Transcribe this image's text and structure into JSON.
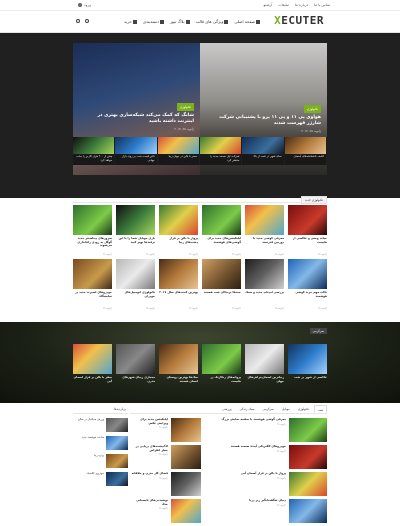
{
  "topbar": {
    "login": "ورود",
    "links": [
      "تماس با ما",
      "درباره ما",
      "تبلیغات",
      "آرشیو"
    ]
  },
  "header": {
    "logo_prefix": "X",
    "logo_rest": "ECUTER",
    "nav": [
      "صفحه اصلی",
      "ویژگی های قالب",
      "بلاگ نیوز",
      "دسته‌بندی",
      "خرید"
    ]
  },
  "hero": {
    "left": {
      "tag": "تکنولوژی",
      "title": "شانگ که کمک می‌کند شبکه‌سازی بهتری در اینترنت داشته باشید",
      "meta": "ژانویه ۲۸، ۲۰۱۷"
    },
    "right": {
      "tag": "تکنولوژی",
      "title": "هواوی پی ۱۱ و پی ۱۱ پرو با پشتیبانی شرکت شارژر فهرست شدند",
      "meta": "ژانویه ۲۸، ۲۰۱۷"
    },
    "strip": [
      "بیش از ۲۰۰ هزار کاربر را جذب خواهد کرد",
      "تاثیر قیمت نفت بر روی بازار جهانی",
      "سفر با بالن در جهان زیبا",
      "شرکت اپل نسخه جدید را منتشر کرد",
      "نمای شهر در شب از بالا",
      "کشف ناشناخته‌های آسمان"
    ]
  },
  "section1": {
    "label": "تکنولوژی جدید",
    "cards": [
      {
        "title": "سرورهای دیتاسنتر جدید گوگل به زودی راه‌اندازی می‌شوند",
        "meta": "ژانویه ۲۸"
      },
      {
        "title": "بازی موبایل شما را با این ترفندها بهتر کنید",
        "meta": "ژانویه ۲۸"
      },
      {
        "title": "پرواز با بالن بر فراز دشت‌های زیبا",
        "meta": "ژانویه ۲۸"
      },
      {
        "title": "اپلیکیشن‌های جدید برای گوشی‌های هوشمند",
        "meta": "ژانویه ۲۸"
      },
      {
        "title": "معرفی گوشی جدید با دوربین قدرتمند",
        "meta": "ژانویه ۲۸"
      },
      {
        "title": "حیات وحش و عکاسی از طبیعت",
        "meta": "ژانویه ۲۸"
      },
      {
        "title": "خودروهای اسپرت جدید در نمایشگاه",
        "meta": "ژانویه ۲۸"
      },
      {
        "title": "تکنولوژی اتومبیل‌های خودران",
        "meta": "ژانویه ۲۸"
      },
      {
        "title": "بهترین گجت‌های سال ۲۰۱۷",
        "meta": "ژانویه ۲۸"
      },
      {
        "title": "جغدها پرندگان شب هستند",
        "meta": "ژانویه ۲۸"
      },
      {
        "title": "بررسی لپ‌تاپ جدید و سبک",
        "meta": "ژانویه ۲۸"
      },
      {
        "title": "نکات مهم خرید گوشی هوشمند",
        "meta": "ژانویه ۲۸"
      }
    ]
  },
  "section2": {
    "label": "سرگرمی",
    "cards": [
      {
        "title": "سفر با بالن بر فراز آسمان آبی",
        "meta": "ژانویه ۲۸"
      },
      {
        "title": "معماری زیبای شهرهای مدرن",
        "meta": "ژانویه ۲۸"
      },
      {
        "title": "سگ‌ها بهترین دوستان انسان هستند",
        "meta": "ژانویه ۲۸"
      },
      {
        "title": "پروانه‌های رنگارنگ در طبیعت",
        "meta": "ژانویه ۲۸"
      },
      {
        "title": "زیباترین آسمان‌خراش‌های جهان",
        "meta": "ژانویه ۲۸"
      },
      {
        "title": "عکاسی از شهر در شب",
        "meta": "ژانویه ۲۸"
      }
    ]
  },
  "tabs": [
    "همه",
    "تکنولوژی",
    "موبایل",
    "سرگرمی",
    "سبک زندگی",
    "ورزشی"
  ],
  "list_right": [
    {
      "title": "معرفی گوشی هوشمند با صفحه نمایش بزرگ",
      "meta": "ژانویه ۲۸"
    },
    {
      "title": "خودروهای الکتریکی آینده صنعت هستند",
      "meta": "ژانویه ۲۸"
    },
    {
      "title": "پرواز با بالن بر فراز آسمان آبی",
      "meta": "ژانویه ۲۸"
    },
    {
      "title": "دنیای شگفت‌انگیز زیر دریا",
      "meta": "ژانویه ۲۸"
    }
  ],
  "list_left": [
    {
      "title": "اپلیکیشن جدید برای ویرایش عکس",
      "meta": "ژانویه ۲۸"
    },
    {
      "title": "لاک‌پشت‌های دریایی در خطر انقراض",
      "meta": "ژانویه ۲۸"
    },
    {
      "title": "فضای کار مدرن و خلاقانه",
      "meta": "ژانویه ۲۸"
    },
    {
      "title": "نوشیدنی‌های تابستانی خنک",
      "meta": "ژانویه ۲۸"
    }
  ],
  "sidebar": {
    "head": "پربازدیدها",
    "items": [
      {
        "title": "ورزش بسکتبال در سالن"
      },
      {
        "title": "ساعت هوشمند جدید"
      },
      {
        "title": "پرتره زیبا"
      },
      {
        "title": "خودروی کلاسیک"
      }
    ]
  }
}
